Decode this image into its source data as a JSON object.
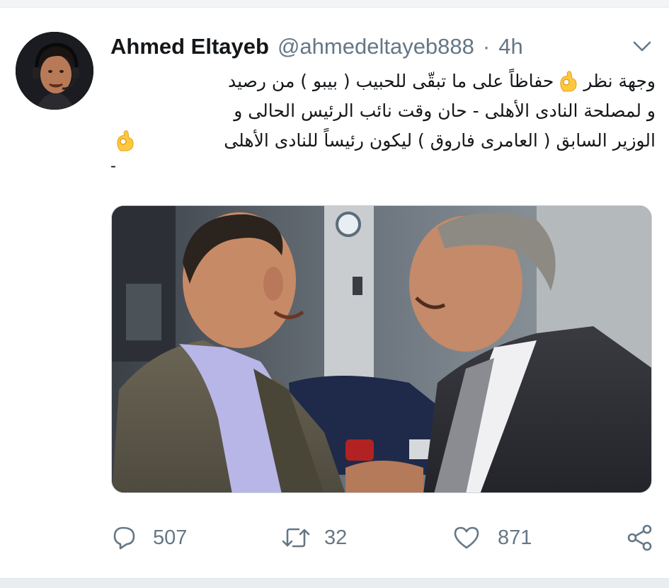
{
  "tweet": {
    "author": {
      "display_name": "Ahmed Eltayeb",
      "handle": "@ahmedeltayeb888",
      "separator": "·",
      "time": "4h"
    },
    "text_lines": {
      "line1_part1": "وجهة نظر",
      "line1_part2": "حفاظاً على ما تبقّى للحبيب ( بيبو ) من رصيد",
      "line2": "و لمصلحة النادى الأهلى - حان وقت نائب الرئيس الحالى و",
      "line3": "الوزير السابق ( العامرى فاروق ) ليكون رئيساً للنادى الأهلى",
      "line4": "-"
    },
    "media_alt_icon": "photo-two-men",
    "actions": {
      "reply_count": "507",
      "retweet_count": "32",
      "like_count": "871",
      "reply_icon": "reply-icon",
      "retweet_icon": "retweet-icon",
      "like_icon": "heart-icon",
      "share_icon": "share-icon"
    }
  },
  "colors": {
    "text_primary": "#14171a",
    "text_secondary": "#657786",
    "emoji_fill": "#ffc83d",
    "border": "#ccd6dd"
  }
}
